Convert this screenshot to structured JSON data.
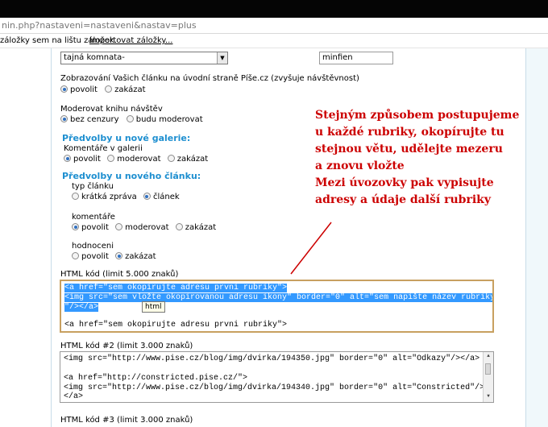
{
  "url": "nin.php?nastaveni=nastaveni&nastav=plus",
  "bookmarks": {
    "hint": "záložky sem na lištu záložek.",
    "import": "Importovat záložky..."
  },
  "room_select": {
    "value": "tajná komnata-"
  },
  "name_input": {
    "value": "minfien"
  },
  "display_section": {
    "label": "Zobrazování Vašich článku na úvodní straně Píše.cz (zvyšuje návštěvnost)",
    "options": [
      "povolit",
      "zakázat"
    ],
    "selected": 0
  },
  "guestbook": {
    "label": "Moderovat knihu návštěv",
    "options": [
      "bez cenzury",
      "budu moderovat"
    ],
    "selected": 0
  },
  "gallery": {
    "heading": "Předvolby u nové galerie:",
    "label": "Komentáře v galerii",
    "options": [
      "povolit",
      "moderovat",
      "zakázat"
    ],
    "selected": 0
  },
  "article": {
    "heading": "Předvolby u nového článku:",
    "type_label": "typ článku",
    "type_options": [
      "krátká zpráva",
      "článek"
    ],
    "type_selected": 1,
    "comments_label": "komentáře",
    "comments_options": [
      "povolit",
      "moderovat",
      "zakázat"
    ],
    "comments_selected": 0,
    "rating_label": "hodnoceni",
    "rating_options": [
      "povolit",
      "zakázat"
    ],
    "rating_selected": 1
  },
  "annotation": [
    "Stejným způsobem postupujeme",
    "u každé rubriky, okopírujte tu",
    "stejnou větu, udělejte mezeru",
    "a znovu vložte",
    "Mezi úvozovky pak vypisujte",
    "adresy a údaje další rubriky"
  ],
  "html1": {
    "label": "HTML kód (limit 5.000 znaků)",
    "lines": [
      "<a href=\"sem okopirujte adresu prvni rubriky\">",
      "<img src=\"sem vložte okopirovanou adresu ikony\" border=\"0\" alt=\"sem napište název rubriky",
      "\"/></a>",
      "",
      "<a href=\"sem okopirujte adresu prvni rubriky\">"
    ],
    "tooltip": "html"
  },
  "html2": {
    "label": "HTML kód #2 (limit 3.000 znaků)",
    "lines": [
      "<img src=\"http://www.pise.cz/blog/img/dvirka/194350.jpg\" border=\"0\" alt=\"Odkazy\"/></a>",
      "",
      "<a href=\"http://constricted.pise.cz/\">",
      "<img src=\"http://www.pise.cz/blog/img/dvirka/194340.jpg\" border=\"0\" alt=\"Constricted\"/>",
      "</a>"
    ]
  },
  "html3": {
    "label": "HTML kód #3 (limit 3.000 znaků)"
  },
  "colors": {
    "heading": "#1e8fd0",
    "annotation": "#cc0000",
    "selection": "#3399ff",
    "frame": "#c8a060"
  }
}
